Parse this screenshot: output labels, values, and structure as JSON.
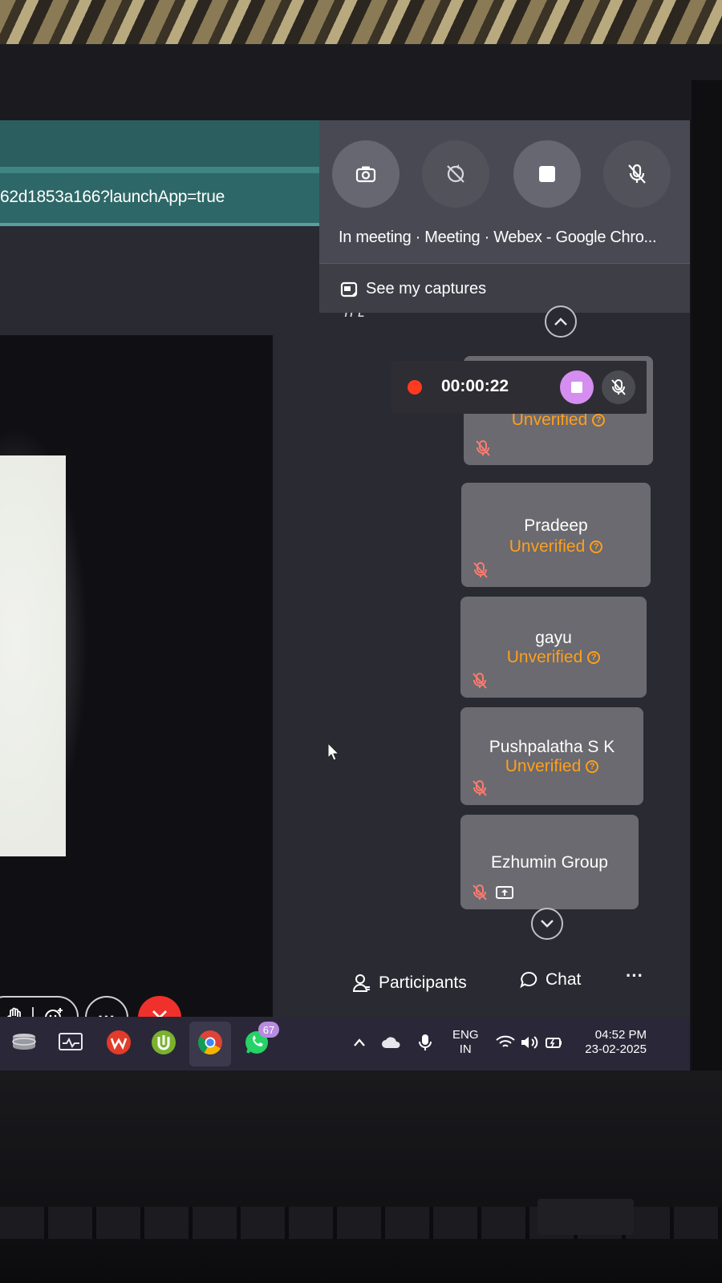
{
  "browser": {
    "url_fragment": "62d1853a166?launchApp=true"
  },
  "capture_popup": {
    "buttons": [
      {
        "icon": "camera-icon"
      },
      {
        "icon": "rotate-off-icon"
      },
      {
        "icon": "stop-icon"
      },
      {
        "icon": "mic-off-icon"
      }
    ],
    "window_title": "In meeting · Meeting · Webex - Google Chro...",
    "see_captures_label": "See my captures"
  },
  "recording": {
    "timer": "00:00:22",
    "dot_color": "#ff3b1f",
    "stop_color": "#d58ef0"
  },
  "participants": [
    {
      "name": "",
      "status": "Unverified",
      "muted": true
    },
    {
      "name": "Pradeep",
      "status": "Unverified",
      "muted": true
    },
    {
      "name": "gayu",
      "status": "Unverified",
      "muted": true
    },
    {
      "name": "Pushpalatha S K",
      "status": "Unverified",
      "muted": true
    },
    {
      "name": "Ezhumin Group",
      "status": "",
      "muted": true,
      "sharing": true
    }
  ],
  "meeting_controls": {
    "participants_label": "Participants",
    "chat_label": "Chat",
    "more_label": "···",
    "overflow_label": "···",
    "leave_color": "#f0302a"
  },
  "taskbar": {
    "whatsapp_badge": "67",
    "language_line1": "ENG",
    "language_line2": "IN",
    "time": "04:52 PM",
    "date": "23-02-2025"
  },
  "colors": {
    "unverified": "#ff9f1c",
    "tile_bg": "#6a6a70",
    "popup_bg": "#494953"
  }
}
